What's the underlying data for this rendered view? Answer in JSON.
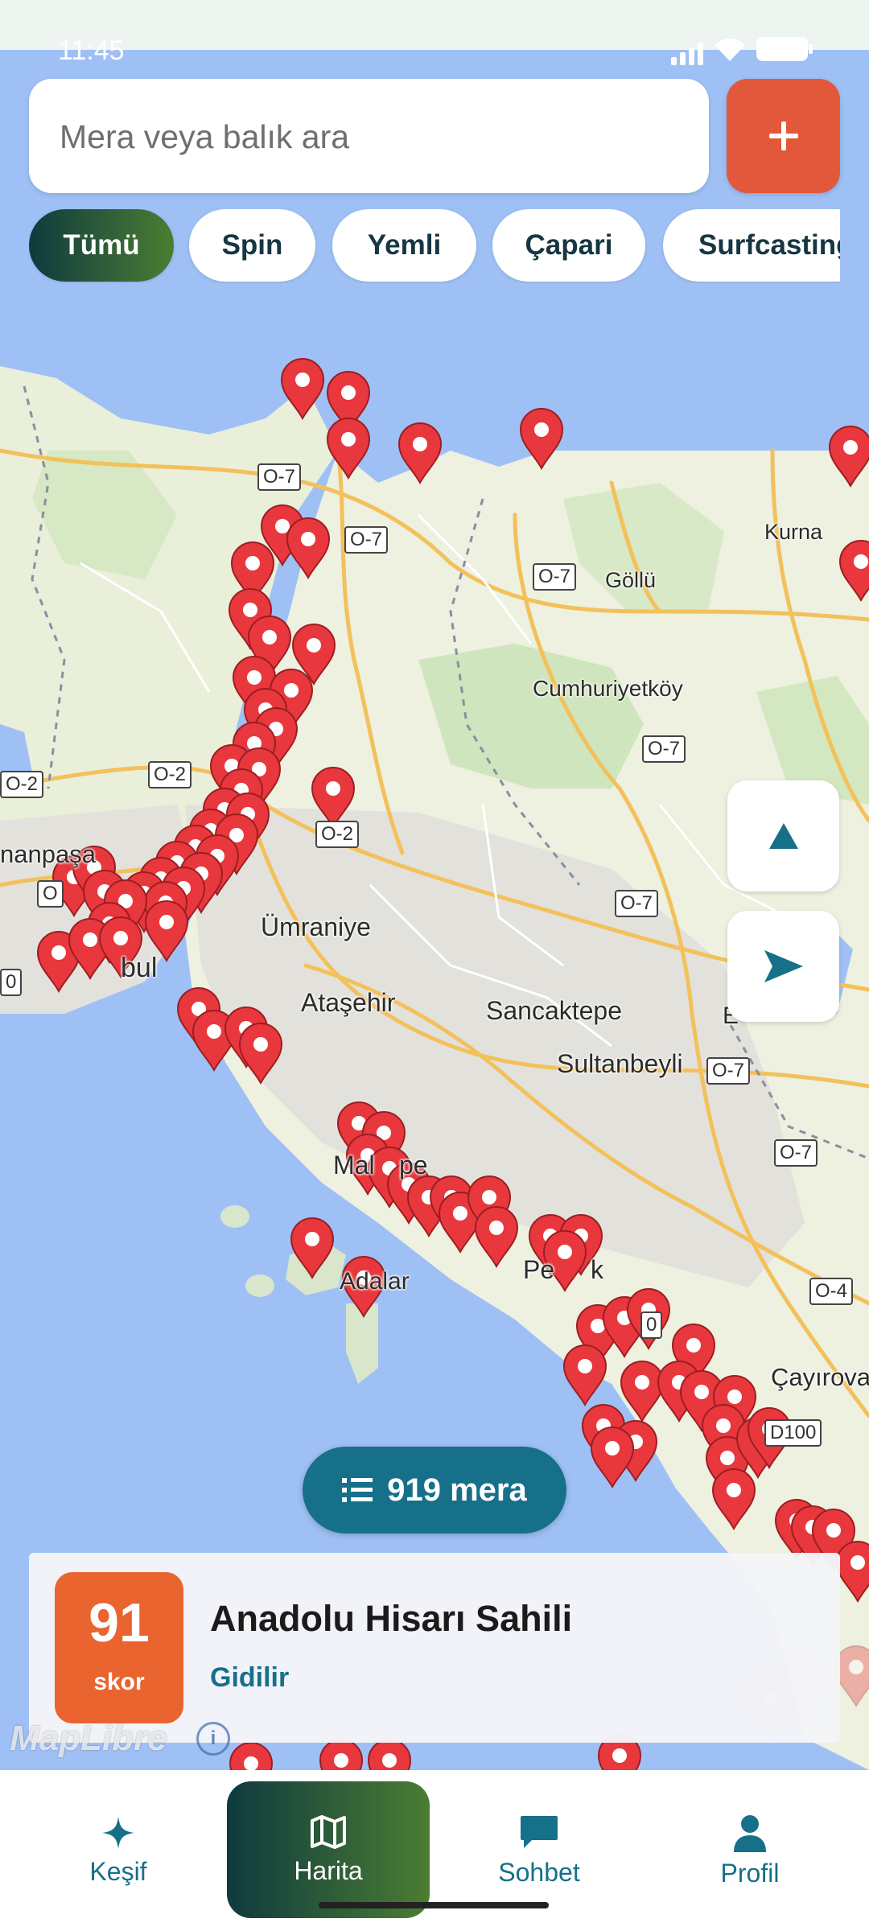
{
  "status_bar": {
    "time": "11:45"
  },
  "search": {
    "placeholder": "Mera veya balık ara"
  },
  "add_button": {
    "icon": "plus-icon",
    "color": "#e2583a"
  },
  "filters": [
    {
      "label": "Tümü",
      "active": true
    },
    {
      "label": "Spin",
      "active": false
    },
    {
      "label": "Yemli",
      "active": false
    },
    {
      "label": "Çapari",
      "active": false
    },
    {
      "label": "Surfcasting",
      "active": false
    }
  ],
  "map": {
    "places": [
      "Kurna",
      "Göllü",
      "Cumhuriyetköy",
      "Ümraniye",
      "Ataşehir",
      "Sancaktepe",
      "Sultanbeyli",
      "Adalar",
      "Çayırova",
      "nanpaşa",
      "bul",
      "Mal",
      "pe",
      "Pe",
      "k",
      "E"
    ],
    "roads": [
      "O-7",
      "O-2",
      "O-4",
      "D100",
      "0",
      "O",
      "0"
    ],
    "marker_color": "#e8383d"
  },
  "map_controls": {
    "north_icon": "compass-north-icon",
    "locate_icon": "location-arrow-icon"
  },
  "count_pill": {
    "icon": "list-icon",
    "label": "919 mera"
  },
  "selected_spot": {
    "score": "91",
    "score_label": "skor",
    "name": "Anadolu Hisarı Sahili",
    "status": "Gidilir"
  },
  "attribution": {
    "logo_text": "MapLibre"
  },
  "bottom_nav": {
    "items": [
      {
        "label": "Keşif",
        "icon": "sparkle-icon"
      },
      {
        "label": "Harita",
        "icon": "map-icon",
        "active": true
      },
      {
        "label": "Sohbet",
        "icon": "chat-icon"
      },
      {
        "label": "Profil",
        "icon": "person-icon"
      }
    ]
  }
}
